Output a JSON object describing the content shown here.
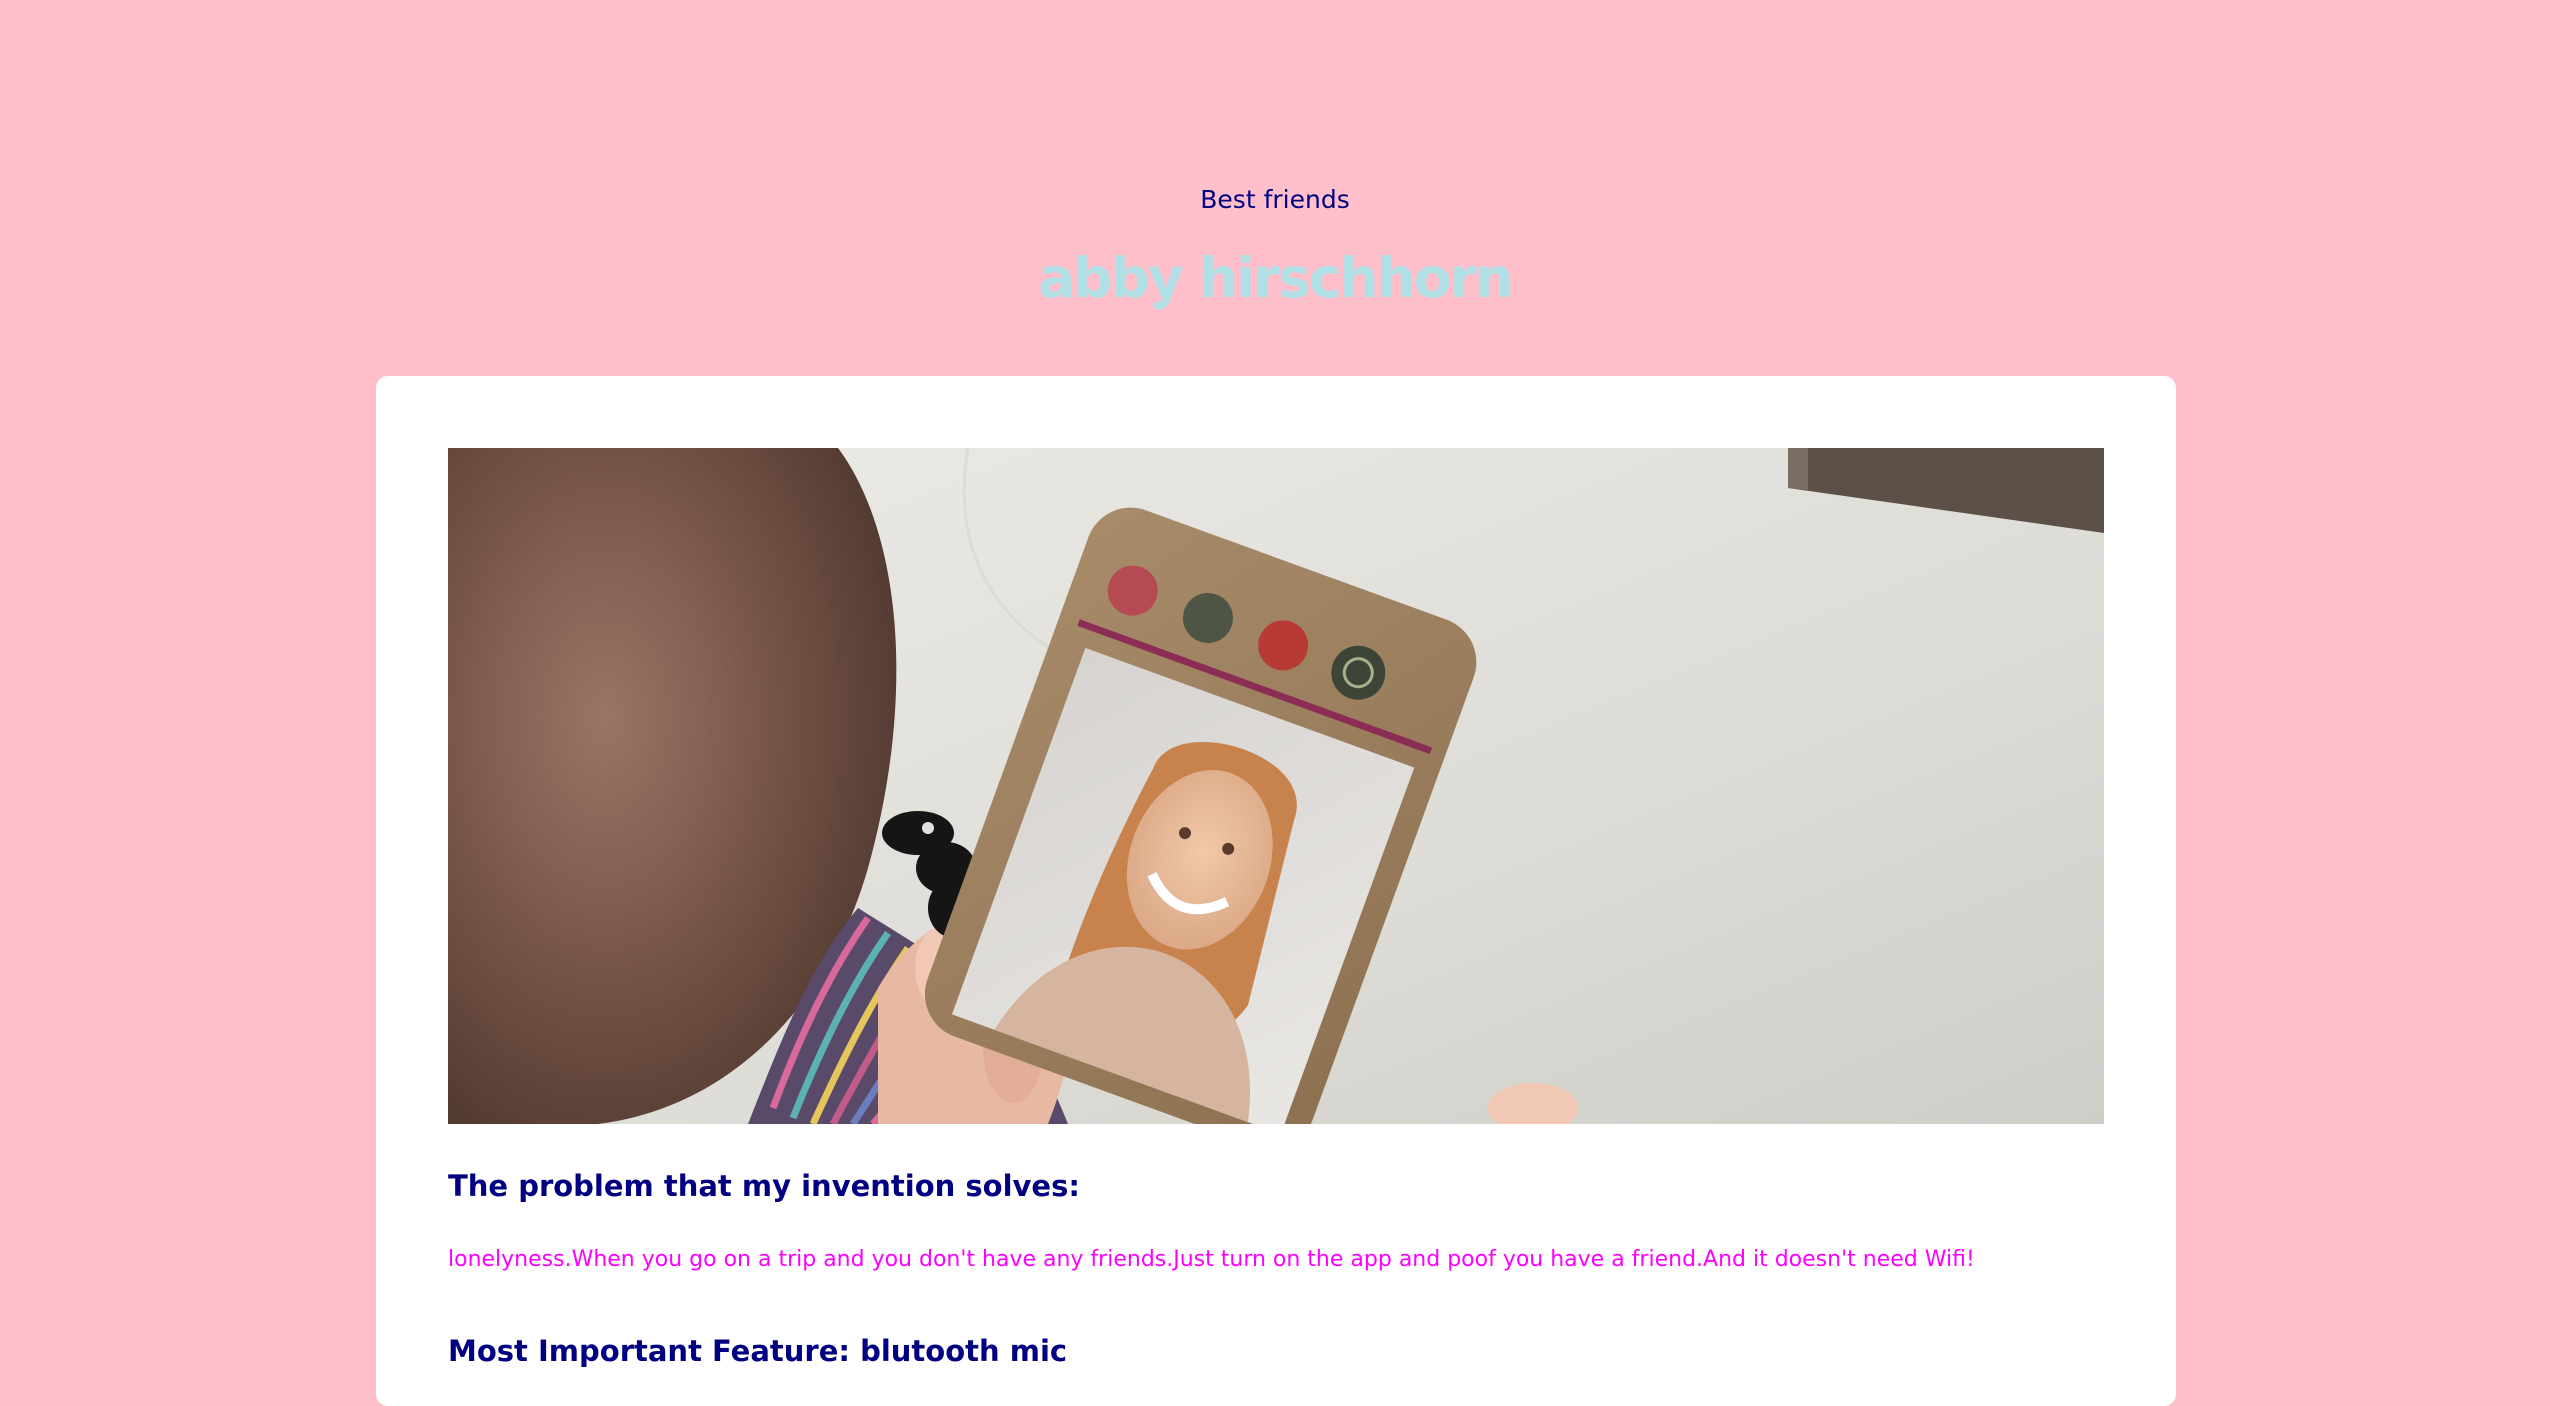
{
  "header": {
    "subtitle": "Best friends",
    "title": "abby hirschhorn"
  },
  "project": {
    "photo_alt": "Invention photo",
    "problem_heading": "The problem that my invention solves:",
    "problem_text": "lonelyness.When you go on a trip and you don't have any friends.Just turn on the app and poof you have a friend.And it doesn't need Wifi!",
    "feature_heading": "Most Important Feature: blutooth mic"
  },
  "colors": {
    "background": "#ffc0cb",
    "subtitle": "#000080",
    "title": "#b0e0e6",
    "card": "#ffffff",
    "heading": "#000080",
    "body_text": "#ff00ff"
  }
}
